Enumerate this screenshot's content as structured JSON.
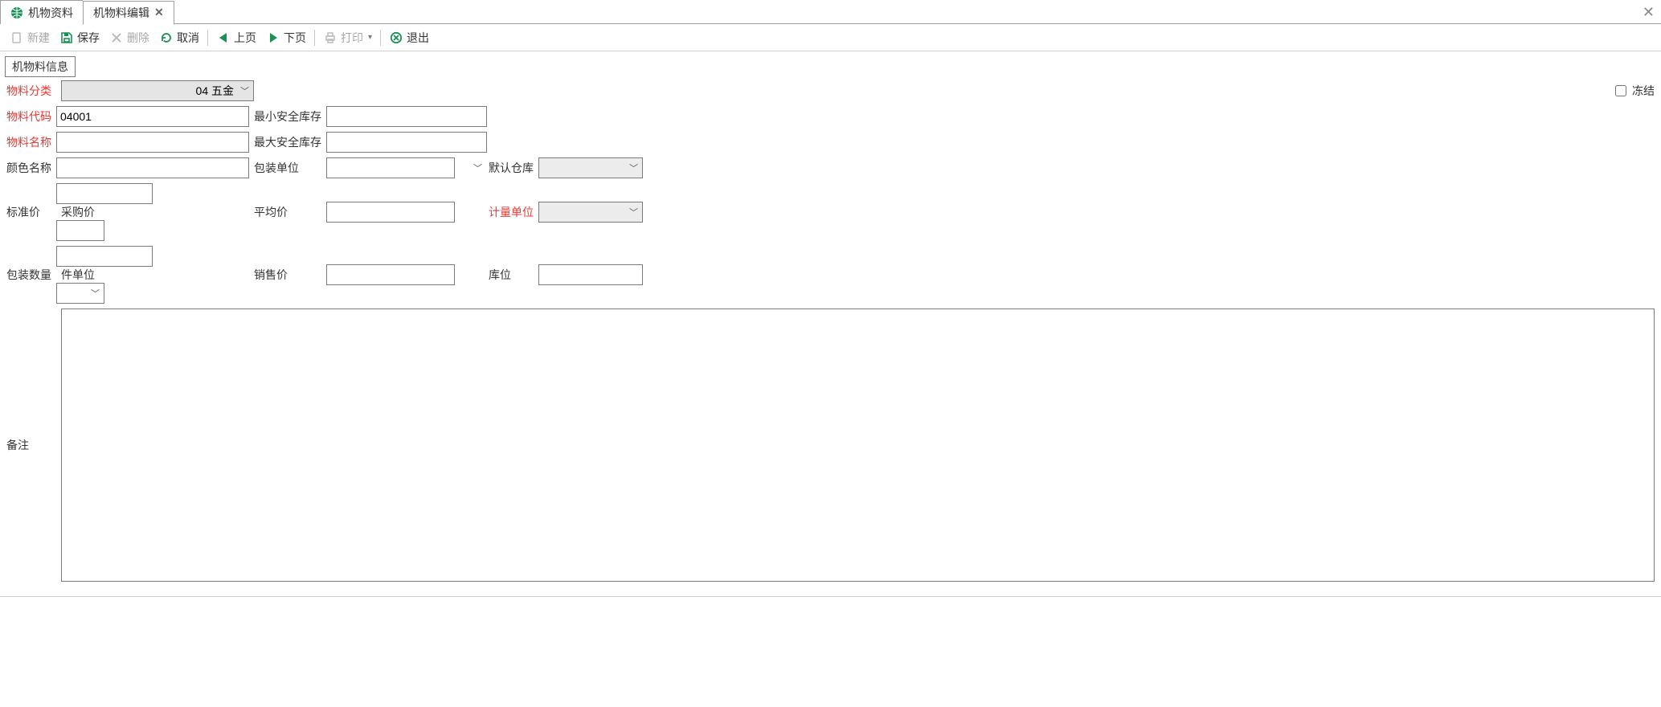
{
  "tabs": {
    "tab1": {
      "label": "机物资料"
    },
    "tab2": {
      "label": "机物料编辑"
    }
  },
  "toolbar": {
    "new": {
      "label": "新建"
    },
    "save": {
      "label": "保存"
    },
    "delete": {
      "label": "删除"
    },
    "cancel": {
      "label": "取消"
    },
    "prev": {
      "label": "上页"
    },
    "next": {
      "label": "下页"
    },
    "print": {
      "label": "打印"
    },
    "exit": {
      "label": "退出"
    }
  },
  "subtab": {
    "label": "机物料信息"
  },
  "freeze": {
    "label": "冻结"
  },
  "form": {
    "category": {
      "label": "物料分类",
      "value": "04 五金"
    },
    "code": {
      "label": "物料代码",
      "value": "04001"
    },
    "min_stock": {
      "label": "最小安全库存",
      "value": ""
    },
    "name": {
      "label": "物料名称",
      "value": ""
    },
    "max_stock": {
      "label": "最大安全库存",
      "value": ""
    },
    "color": {
      "label": "颜色名称",
      "value": ""
    },
    "pack_unit": {
      "label": "包装单位",
      "value": ""
    },
    "default_wh": {
      "label": "默认仓库",
      "value": ""
    },
    "std_price": {
      "label": "标准价",
      "value": ""
    },
    "purchase_price": {
      "label": "采购价",
      "value": ""
    },
    "avg_price": {
      "label": "平均价",
      "value": ""
    },
    "measure_unit": {
      "label": "计量单位",
      "value": ""
    },
    "pack_qty": {
      "label": "包装数量",
      "value": ""
    },
    "piece_unit": {
      "label": "件单位",
      "value": ""
    },
    "sale_price": {
      "label": "销售价",
      "value": ""
    },
    "location": {
      "label": "库位",
      "value": ""
    },
    "remark": {
      "label": "备注",
      "value": ""
    }
  }
}
